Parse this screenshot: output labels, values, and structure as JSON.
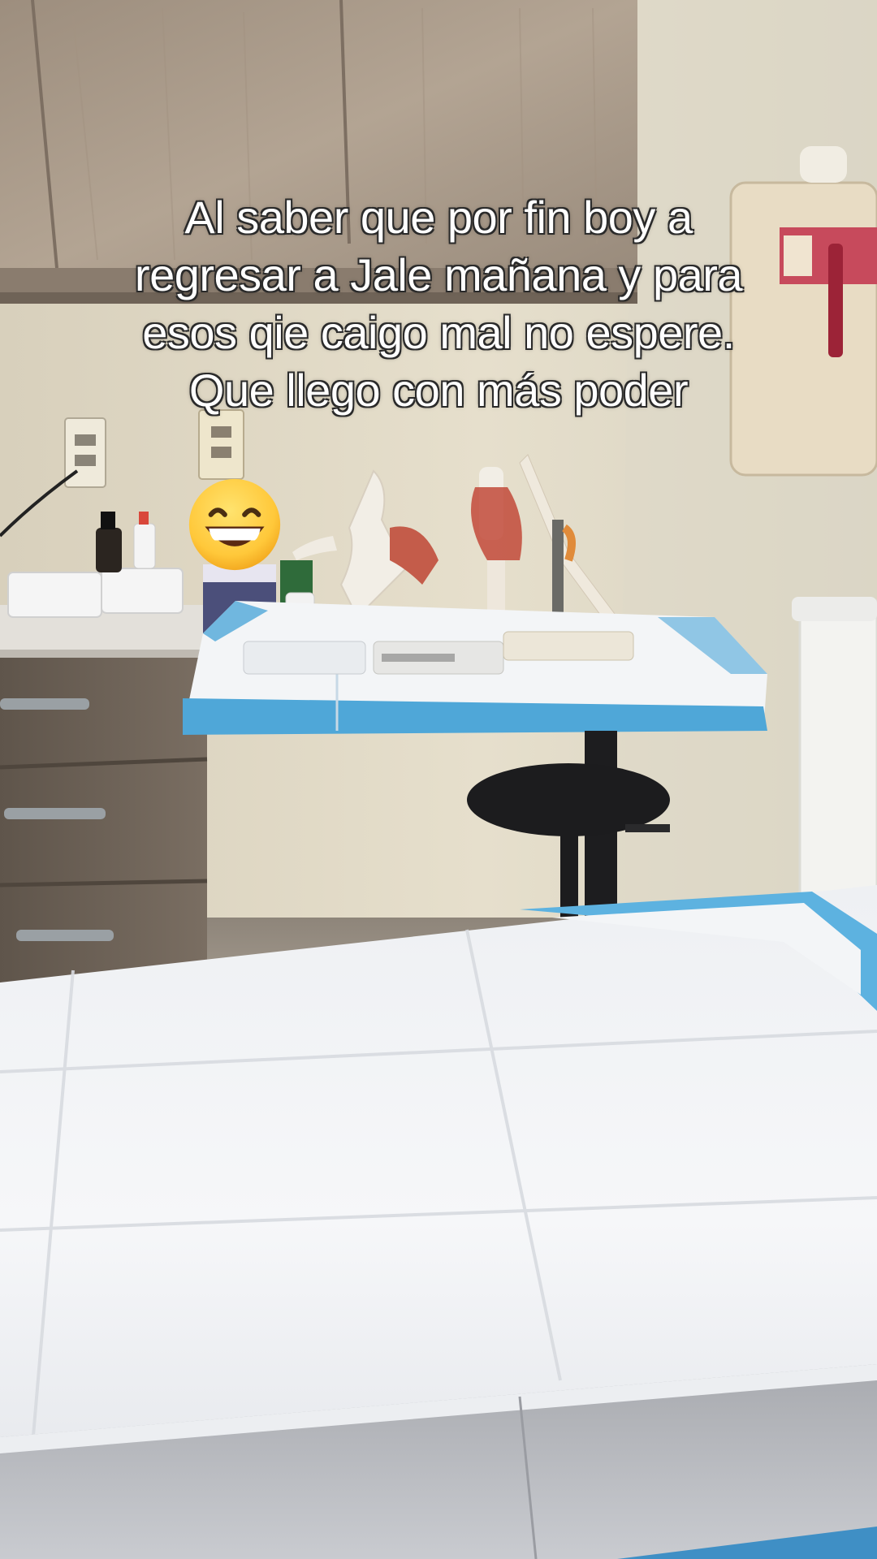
{
  "caption": {
    "lines": [
      "Al saber que por fin boy a",
      "regresar a Jale mañana y para",
      "esos qie caigo mal no espere.",
      "Que llego con más poder"
    ]
  },
  "sticker": {
    "emoji_name": "grinning-face-with-smiling-eyes-emoji"
  },
  "colors": {
    "wall": "#e2dcc8",
    "cabinet_wood": "#a39383",
    "lower_cabinet": "#6e6358",
    "table_paper": "#f4f5f7",
    "blue_pad_edge": "#4fa7d8",
    "stool": "#1c1c1e"
  }
}
